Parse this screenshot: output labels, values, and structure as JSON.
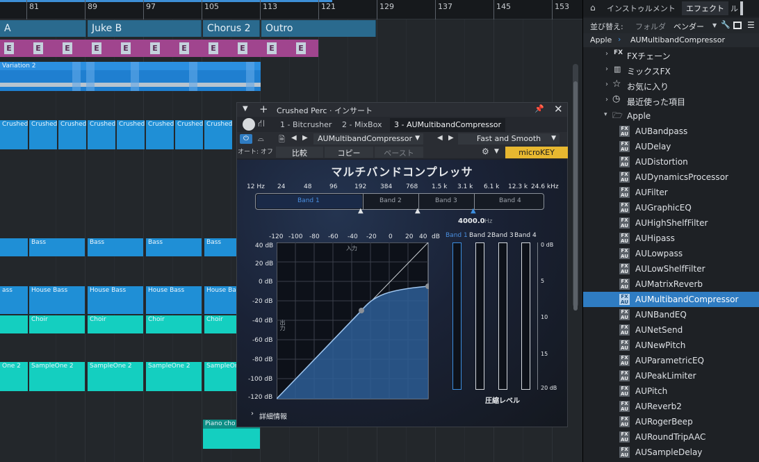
{
  "ruler": {
    "labels": [
      "81",
      "89",
      "97",
      "105",
      "113",
      "121",
      "129",
      "137",
      "145",
      "153"
    ]
  },
  "markers": [
    "A",
    "Juke B",
    "Chorus 2",
    "Outro"
  ],
  "events": {
    "e_label": "E"
  },
  "clips": {
    "variation": "Variation 2",
    "crushed": "Crushed",
    "bass": "Bass",
    "house_bass": "House Bass",
    "house_bass_cut": "ass",
    "choir": "Choir",
    "sampleone": "SampleOne 2",
    "sampleone_cut": "One 2",
    "piano": "Piano cho"
  },
  "plugin": {
    "title": "Crushed Perc · インサート",
    "tabs": [
      "1 - Bitcrusher",
      "2 - MixBox",
      "3 - AUMultibandCompressor"
    ],
    "auto_off": "オート: オフ",
    "compare": "比較",
    "copy": "コピー",
    "paste": "ペースト",
    "plugin_name": "AUMultibandCompressor",
    "preset": "Fast and Smooth",
    "microkey": "microKEY",
    "heading": "マルチバンドコンプレッサ",
    "freq_labels": [
      "12 Hz",
      "24",
      "48",
      "96",
      "192",
      "384",
      "768",
      "1.5 k",
      "3.1 k",
      "6.1 k",
      "12.3 k",
      "24.6 kHz"
    ],
    "bands": [
      "Band 1",
      "Band 2",
      "Band 3",
      "Band 4"
    ],
    "crossover_value": "4000.0",
    "crossover_unit": "Hz",
    "input_label": "入力",
    "output_label": "出力",
    "x_axis": [
      "-120",
      "-100",
      "-80",
      "-60",
      "-40",
      "-20",
      "0",
      "20",
      "40"
    ],
    "x_unit": "dB",
    "y_axis": [
      "40 dB",
      "20 dB",
      "0 dB",
      "-20 dB",
      "-40 dB",
      "-60 dB",
      "-80 dB",
      "-100 dB",
      "-120 dB"
    ],
    "meter_scale": [
      "0 dB",
      "5",
      "10",
      "15",
      "20 dB"
    ],
    "meter_caption": "圧縮レベル",
    "details": "詳細情報"
  },
  "browser": {
    "tabs": [
      "インストゥルメント",
      "エフェクト",
      "ル"
    ],
    "sort_label": "並び替え:",
    "sort_folder": "フォルダ",
    "sort_vendor": "ベンダー",
    "breadcrumb_root": "Apple",
    "breadcrumb_leaf": "AUMultibandCompressor",
    "folders": [
      "FXチェーン",
      "ミックスFX",
      "お気に入り",
      "最近使った項目"
    ],
    "apple_folder": "Apple",
    "items": [
      "AUBandpass",
      "AUDelay",
      "AUDistortion",
      "AUDynamicsProcessor",
      "AUFilter",
      "AUGraphicEQ",
      "AUHighShelfFilter",
      "AUHipass",
      "AULowpass",
      "AULowShelfFilter",
      "AUMatrixReverb",
      "AUMultibandCompressor",
      "AUNBandEQ",
      "AUNetSend",
      "AUNewPitch",
      "AUParametricEQ",
      "AUPeakLimiter",
      "AUPitch",
      "AUReverb2",
      "AURogerBeep",
      "AURoundTripAAC",
      "AUSampleDelay"
    ],
    "selected": "AUMultibandCompressor"
  },
  "colors": {
    "accent": "#2f7cc2",
    "clip_blue": "#1f8fd6",
    "clip_teal": "#14cfc0",
    "event_purple": "#a0458e",
    "marker": "#2a6a8e",
    "microkey": "#e8b830"
  }
}
